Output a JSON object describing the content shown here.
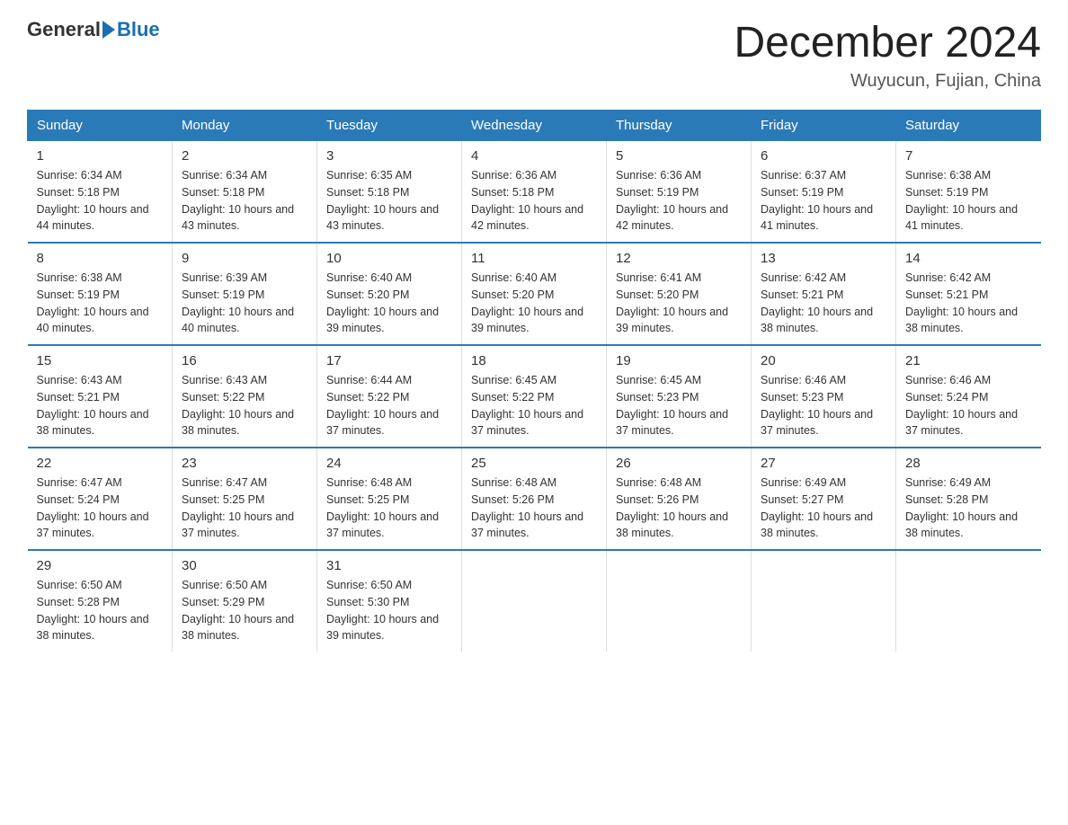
{
  "header": {
    "logo_general": "General",
    "logo_blue": "Blue",
    "month_year": "December 2024",
    "location": "Wuyucun, Fujian, China"
  },
  "days_of_week": [
    "Sunday",
    "Monday",
    "Tuesday",
    "Wednesday",
    "Thursday",
    "Friday",
    "Saturday"
  ],
  "weeks": [
    [
      {
        "day": "1",
        "sunrise": "6:34 AM",
        "sunset": "5:18 PM",
        "daylight": "10 hours and 44 minutes."
      },
      {
        "day": "2",
        "sunrise": "6:34 AM",
        "sunset": "5:18 PM",
        "daylight": "10 hours and 43 minutes."
      },
      {
        "day": "3",
        "sunrise": "6:35 AM",
        "sunset": "5:18 PM",
        "daylight": "10 hours and 43 minutes."
      },
      {
        "day": "4",
        "sunrise": "6:36 AM",
        "sunset": "5:18 PM",
        "daylight": "10 hours and 42 minutes."
      },
      {
        "day": "5",
        "sunrise": "6:36 AM",
        "sunset": "5:19 PM",
        "daylight": "10 hours and 42 minutes."
      },
      {
        "day": "6",
        "sunrise": "6:37 AM",
        "sunset": "5:19 PM",
        "daylight": "10 hours and 41 minutes."
      },
      {
        "day": "7",
        "sunrise": "6:38 AM",
        "sunset": "5:19 PM",
        "daylight": "10 hours and 41 minutes."
      }
    ],
    [
      {
        "day": "8",
        "sunrise": "6:38 AM",
        "sunset": "5:19 PM",
        "daylight": "10 hours and 40 minutes."
      },
      {
        "day": "9",
        "sunrise": "6:39 AM",
        "sunset": "5:19 PM",
        "daylight": "10 hours and 40 minutes."
      },
      {
        "day": "10",
        "sunrise": "6:40 AM",
        "sunset": "5:20 PM",
        "daylight": "10 hours and 39 minutes."
      },
      {
        "day": "11",
        "sunrise": "6:40 AM",
        "sunset": "5:20 PM",
        "daylight": "10 hours and 39 minutes."
      },
      {
        "day": "12",
        "sunrise": "6:41 AM",
        "sunset": "5:20 PM",
        "daylight": "10 hours and 39 minutes."
      },
      {
        "day": "13",
        "sunrise": "6:42 AM",
        "sunset": "5:21 PM",
        "daylight": "10 hours and 38 minutes."
      },
      {
        "day": "14",
        "sunrise": "6:42 AM",
        "sunset": "5:21 PM",
        "daylight": "10 hours and 38 minutes."
      }
    ],
    [
      {
        "day": "15",
        "sunrise": "6:43 AM",
        "sunset": "5:21 PM",
        "daylight": "10 hours and 38 minutes."
      },
      {
        "day": "16",
        "sunrise": "6:43 AM",
        "sunset": "5:22 PM",
        "daylight": "10 hours and 38 minutes."
      },
      {
        "day": "17",
        "sunrise": "6:44 AM",
        "sunset": "5:22 PM",
        "daylight": "10 hours and 37 minutes."
      },
      {
        "day": "18",
        "sunrise": "6:45 AM",
        "sunset": "5:22 PM",
        "daylight": "10 hours and 37 minutes."
      },
      {
        "day": "19",
        "sunrise": "6:45 AM",
        "sunset": "5:23 PM",
        "daylight": "10 hours and 37 minutes."
      },
      {
        "day": "20",
        "sunrise": "6:46 AM",
        "sunset": "5:23 PM",
        "daylight": "10 hours and 37 minutes."
      },
      {
        "day": "21",
        "sunrise": "6:46 AM",
        "sunset": "5:24 PM",
        "daylight": "10 hours and 37 minutes."
      }
    ],
    [
      {
        "day": "22",
        "sunrise": "6:47 AM",
        "sunset": "5:24 PM",
        "daylight": "10 hours and 37 minutes."
      },
      {
        "day": "23",
        "sunrise": "6:47 AM",
        "sunset": "5:25 PM",
        "daylight": "10 hours and 37 minutes."
      },
      {
        "day": "24",
        "sunrise": "6:48 AM",
        "sunset": "5:25 PM",
        "daylight": "10 hours and 37 minutes."
      },
      {
        "day": "25",
        "sunrise": "6:48 AM",
        "sunset": "5:26 PM",
        "daylight": "10 hours and 37 minutes."
      },
      {
        "day": "26",
        "sunrise": "6:48 AM",
        "sunset": "5:26 PM",
        "daylight": "10 hours and 38 minutes."
      },
      {
        "day": "27",
        "sunrise": "6:49 AM",
        "sunset": "5:27 PM",
        "daylight": "10 hours and 38 minutes."
      },
      {
        "day": "28",
        "sunrise": "6:49 AM",
        "sunset": "5:28 PM",
        "daylight": "10 hours and 38 minutes."
      }
    ],
    [
      {
        "day": "29",
        "sunrise": "6:50 AM",
        "sunset": "5:28 PM",
        "daylight": "10 hours and 38 minutes."
      },
      {
        "day": "30",
        "sunrise": "6:50 AM",
        "sunset": "5:29 PM",
        "daylight": "10 hours and 38 minutes."
      },
      {
        "day": "31",
        "sunrise": "6:50 AM",
        "sunset": "5:30 PM",
        "daylight": "10 hours and 39 minutes."
      },
      null,
      null,
      null,
      null
    ]
  ],
  "labels": {
    "sunrise_prefix": "Sunrise: ",
    "sunset_prefix": "Sunset: ",
    "daylight_prefix": "Daylight: "
  }
}
